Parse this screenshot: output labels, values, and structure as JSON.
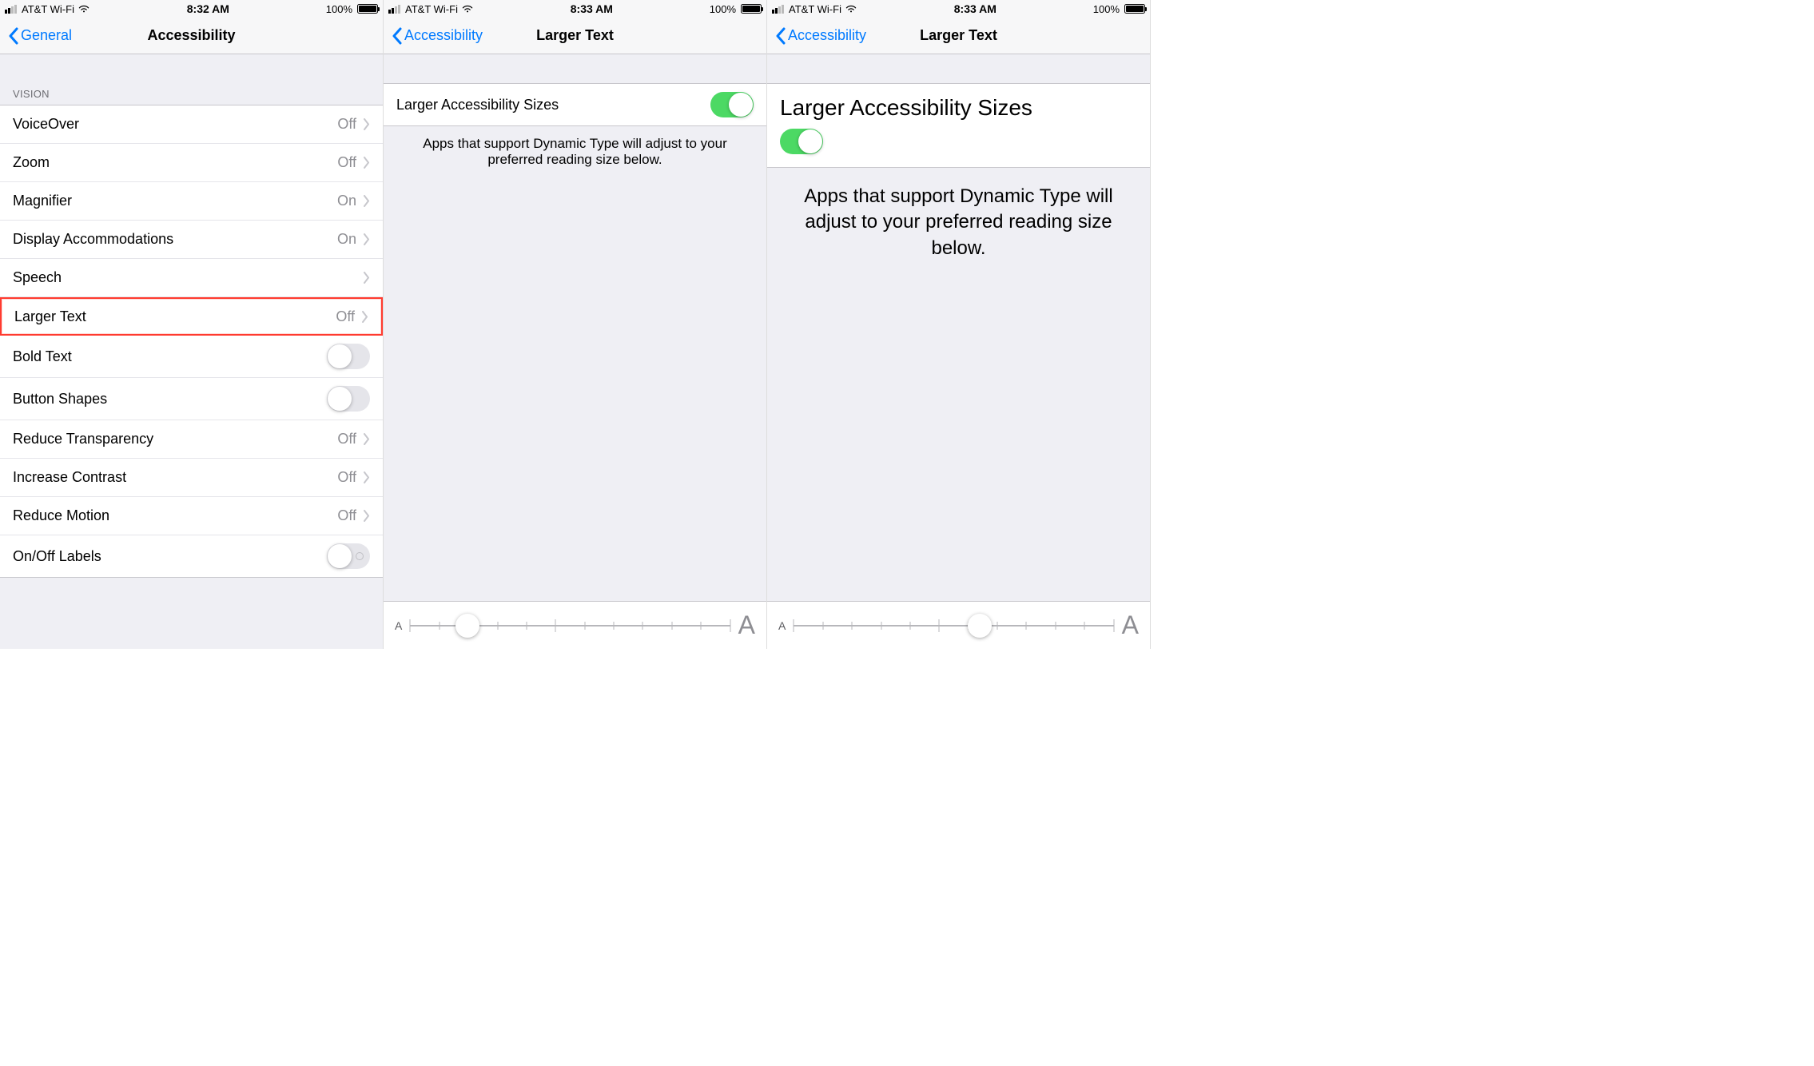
{
  "statusA": {
    "carrier": "AT&T Wi-Fi",
    "time": "8:32 AM",
    "battery_pct": "100%"
  },
  "statusB": {
    "carrier": "AT&T Wi-Fi",
    "time": "8:33 AM",
    "battery_pct": "100%"
  },
  "statusC": {
    "carrier": "AT&T Wi-Fi",
    "time": "8:33 AM",
    "battery_pct": "100%"
  },
  "screen1": {
    "back": "General",
    "title": "Accessibility",
    "section_vision": "VISION",
    "rows": {
      "voiceover": {
        "label": "VoiceOver",
        "value": "Off"
      },
      "zoom": {
        "label": "Zoom",
        "value": "Off"
      },
      "magnifier": {
        "label": "Magnifier",
        "value": "On"
      },
      "display": {
        "label": "Display Accommodations",
        "value": "On"
      },
      "speech": {
        "label": "Speech",
        "value": ""
      },
      "larger": {
        "label": "Larger Text",
        "value": "Off"
      },
      "bold": {
        "label": "Bold Text"
      },
      "shapes": {
        "label": "Button Shapes"
      },
      "transp": {
        "label": "Reduce Transparency",
        "value": "Off"
      },
      "contrast": {
        "label": "Increase Contrast",
        "value": "Off"
      },
      "motion": {
        "label": "Reduce Motion",
        "value": "Off"
      },
      "onoff": {
        "label": "On/Off Labels"
      }
    }
  },
  "screen2": {
    "back": "Accessibility",
    "title": "Larger Text",
    "toggle_label": "Larger Accessibility Sizes",
    "toggle_on": true,
    "footer": "Apps that support Dynamic Type will adjust to your preferred reading size below.",
    "slider": {
      "small": "A",
      "large": "A",
      "position_pct": 18,
      "tick_count": 12
    }
  },
  "screen3": {
    "back": "Accessibility",
    "title": "Larger Text",
    "toggle_label": "Larger Accessibility Sizes",
    "toggle_on": true,
    "footer": "Apps that support Dynamic Type will adjust to your preferred reading size below.",
    "slider": {
      "small": "A",
      "large": "A",
      "position_pct": 58,
      "tick_count": 12
    }
  }
}
